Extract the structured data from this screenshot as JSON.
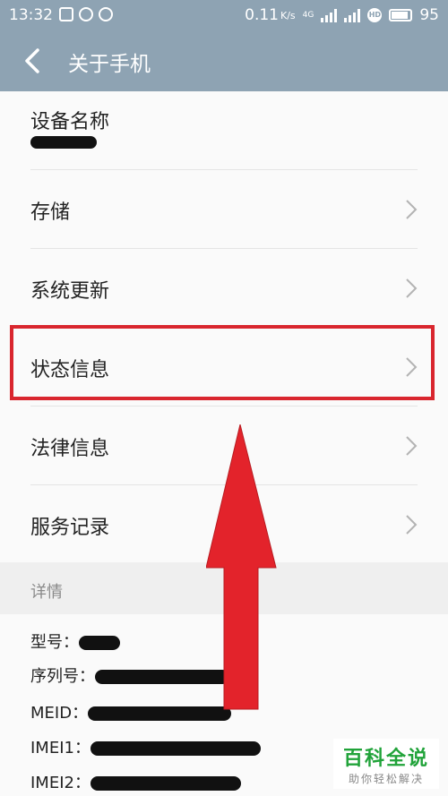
{
  "status_bar": {
    "time": "13:32",
    "speed": "0.11",
    "speed_unit": "K/s",
    "network": "4G",
    "battery": "95"
  },
  "header": {
    "title": "关于手机"
  },
  "list": {
    "items": [
      {
        "label": "设备名称"
      },
      {
        "label": "存储"
      },
      {
        "label": "系统更新"
      },
      {
        "label": "状态信息"
      },
      {
        "label": "法律信息"
      },
      {
        "label": "服务记录"
      }
    ]
  },
  "details": {
    "section_label": "详情",
    "fields": [
      {
        "label": "型号："
      },
      {
        "label": "序列号："
      },
      {
        "label": "MEID："
      },
      {
        "label": "IMEI1："
      },
      {
        "label": "IMEI2："
      }
    ]
  },
  "watermark": {
    "main": "百科全说",
    "sub": "助你轻松解决"
  },
  "colors": {
    "header": "#8ea3b3",
    "highlight": "#d9262e",
    "arrow": "#e3232b",
    "watermark": "#21a33a"
  },
  "icons": {
    "back": "chevron-left-icon",
    "row_arrow": "chevron-right-icon",
    "annotation": "red-up-arrow"
  }
}
